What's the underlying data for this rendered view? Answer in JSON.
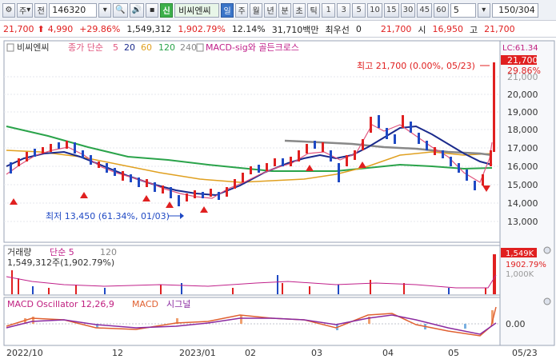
{
  "toolbar": {
    "market": "주",
    "tab_prev": "전",
    "code": "146320",
    "name_badge": "신",
    "stock_name": "비씨엔씨",
    "period_tabs": [
      "일",
      "주",
      "월",
      "년",
      "분",
      "초",
      "틱"
    ],
    "intervals": [
      "1",
      "3",
      "5",
      "10",
      "15",
      "30",
      "45",
      "60"
    ],
    "interval_select": "5",
    "page_counter": "150/304"
  },
  "quote": {
    "price": "21,700",
    "change": "4,990",
    "change_pct": "+29.86%",
    "volume": "1,549,312",
    "volume_pct": "1,902.79%",
    "turnover": "12.14%",
    "amount": "31,710백만",
    "priority_label": "최우선",
    "priority_value": "0",
    "ask": "21,700",
    "open_label": "시",
    "open": "16,950",
    "high_label": "고",
    "high": "21,700"
  },
  "legend": {
    "stock": "비씨엔씨",
    "ma_label": "종가 단순",
    "ma_periods": [
      "5",
      "20",
      "60",
      "120",
      "240"
    ],
    "macd_label": "MACD-sig와 골든크로스"
  },
  "annotations": {
    "high": "최고 21,700 (0.00%, 05/23)",
    "low": "최저 13,450 (61.34%, 01/03)"
  },
  "price_axis": {
    "labels": [
      "20,000",
      "19,000",
      "18,000",
      "17,000",
      "16,000",
      "15,000",
      "14,000",
      "13,000"
    ],
    "top_label": "LC:61.34",
    "current": "21,700",
    "current_pct": "29.86%",
    "partial": "21,000"
  },
  "volume_panel": {
    "title": "거래량",
    "ma_label": "단순 5",
    "ma_period": "120",
    "value": "1,549,312주(1,902.79%)",
    "axis_current": "1,549K",
    "axis_pct": "1902.79%",
    "axis_partial": "1,000K"
  },
  "macd_panel": {
    "title": "MACD Oscillator 12,26,9",
    "macd": "MACD",
    "signal": "시그널",
    "axis_zero": "0.00"
  },
  "x_axis": [
    "2022/10",
    "12",
    "2023/01",
    "02",
    "03",
    "04",
    "05",
    "05/23"
  ],
  "colors": {
    "up": "#e02020",
    "down": "#1f49c4",
    "ma5": "#e0557e",
    "ma20": "#1a2a8c",
    "ma60": "#e0a020",
    "ma120": "#2aa34a",
    "ma240": "#888888",
    "macd": "#e06030",
    "signal": "#8a2aa0"
  }
}
